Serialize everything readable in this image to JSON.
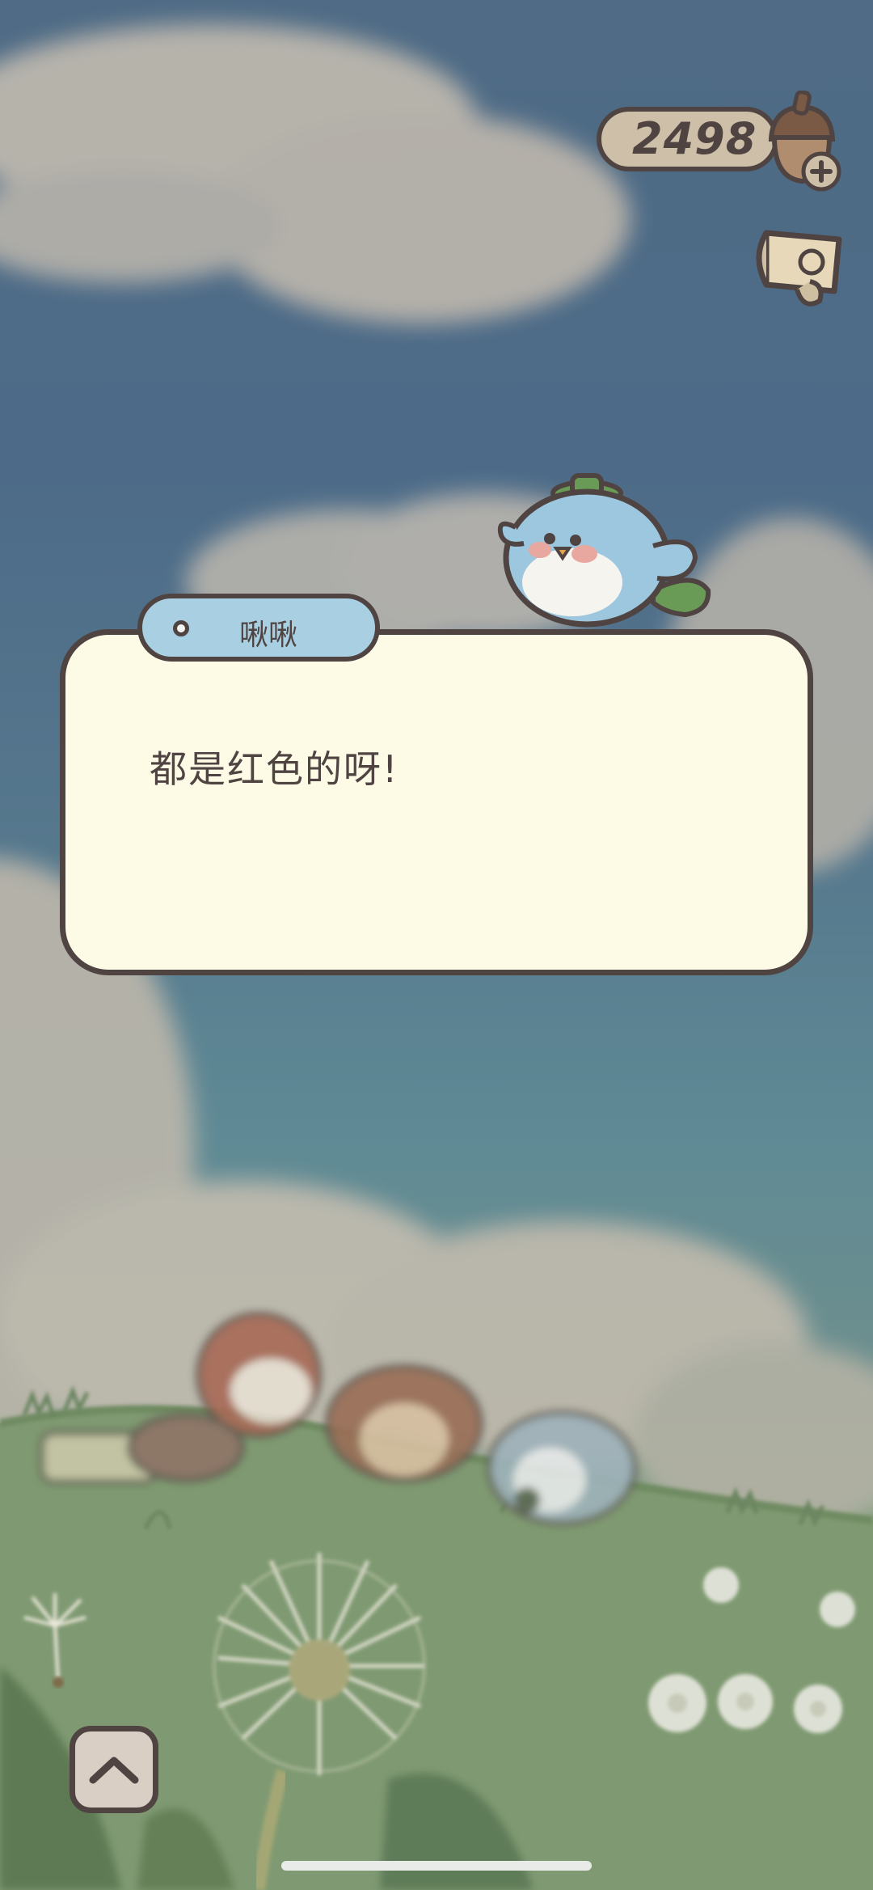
{
  "hud": {
    "currency_amount": "2498",
    "currency_icon": "acorn-icon",
    "add_icon": "plus-icon",
    "scroll_icon": "scroll-map-icon"
  },
  "dialog": {
    "speaker": "啾啾",
    "text": "都是红色的呀!"
  },
  "controls": {
    "expand_icon": "chevron-up-icon"
  },
  "colors": {
    "outline": "#4f4442",
    "dialog_bg": "#fdfbe6",
    "name_tab_bg": "#a9cfe3",
    "sky": "#4f6b85",
    "grass": "#7e9972"
  }
}
